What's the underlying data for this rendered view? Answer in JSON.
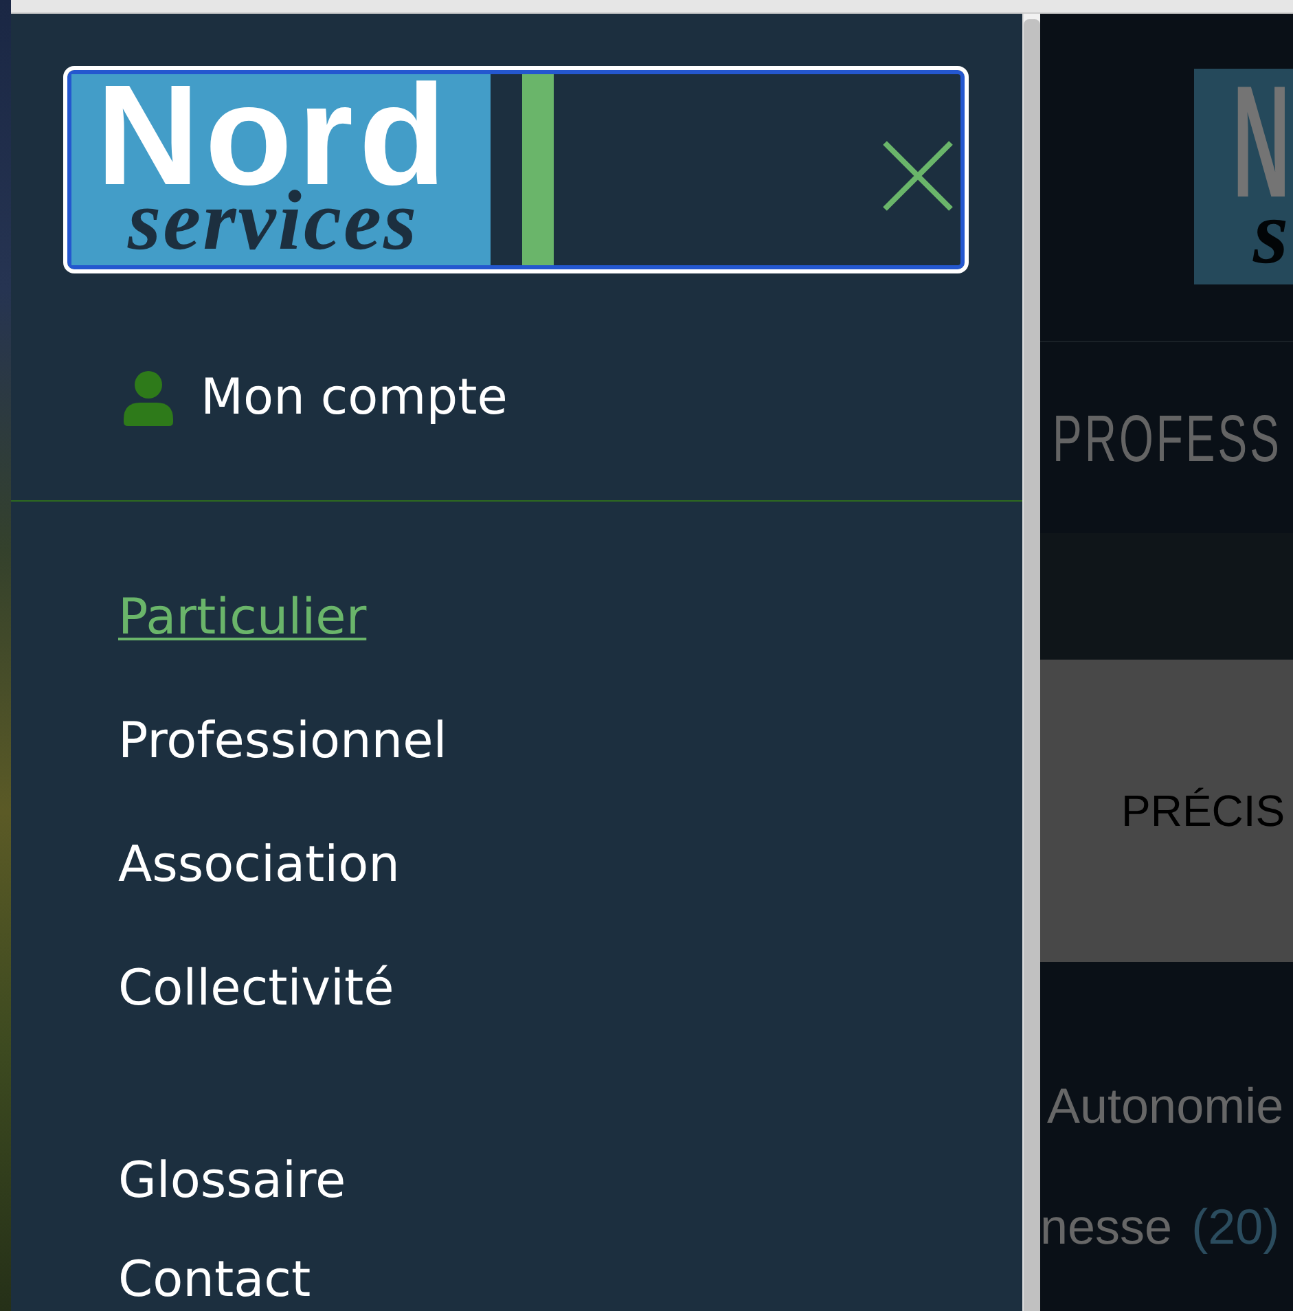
{
  "drawer": {
    "logo": {
      "title": "Nord",
      "subtitle": "services"
    },
    "account_link": {
      "label": "Mon compte"
    },
    "primary_menu": [
      {
        "label": "Particulier",
        "selected": true
      },
      {
        "label": "Professionnel",
        "selected": false
      },
      {
        "label": "Association",
        "selected": false
      },
      {
        "label": "Collectivité",
        "selected": false
      }
    ],
    "secondary_menu": [
      {
        "label": "Glossaire",
        "selected": false
      },
      {
        "label": "Contact",
        "selected": false
      }
    ]
  },
  "background_page": {
    "logo": {
      "title": "N",
      "subtitle": "s"
    },
    "nav_label": "PROFESS",
    "banner_text": "PRÉCIS",
    "filters": [
      {
        "label": "Autonomie"
      },
      {
        "label": "nesse",
        "count": "(20)"
      }
    ]
  }
}
